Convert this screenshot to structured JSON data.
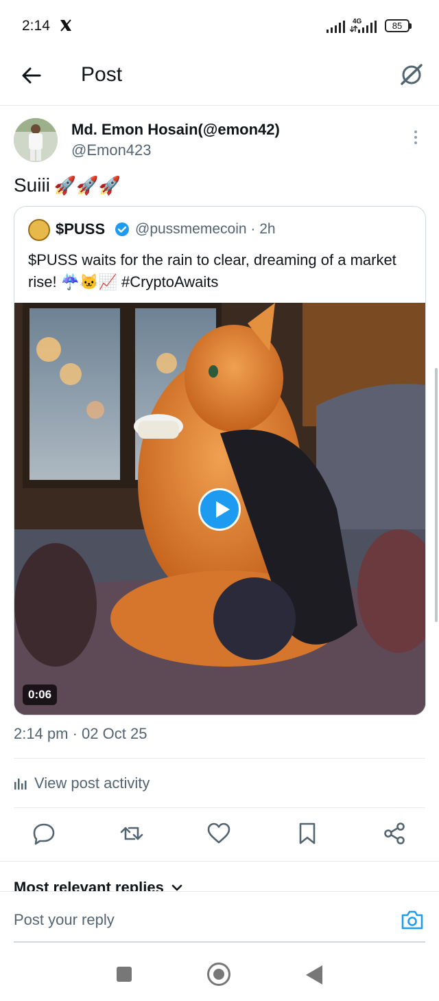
{
  "status_bar": {
    "time": "2:14",
    "network": "4G",
    "battery": "85"
  },
  "header": {
    "title": "Post"
  },
  "post": {
    "author_name": "Md. Emon Hosain(@emon42)",
    "author_handle": "@Emon423",
    "text": "Suiii",
    "emoji": "🚀🚀🚀",
    "timestamp": "2:14 pm · 02 Oct 25"
  },
  "quoted": {
    "name": "$PUSS",
    "handle_time": "@pussmemecoin · 2h",
    "text": "$PUSS waits for the rain to clear, dreaming of a market rise! ☔🐱📈  #CryptoAwaits",
    "video_duration": "0:06"
  },
  "activity": {
    "label": "View post activity"
  },
  "actions": [
    "reply-icon",
    "repost-icon",
    "like-icon",
    "bookmark-icon",
    "share-icon"
  ],
  "replies": {
    "sort_label": "Most relevant replies"
  },
  "reply_bar": {
    "placeholder": "Post your reply"
  },
  "colors": {
    "accent": "#1d9bf0",
    "text": "#0f1419",
    "muted": "#536471"
  }
}
